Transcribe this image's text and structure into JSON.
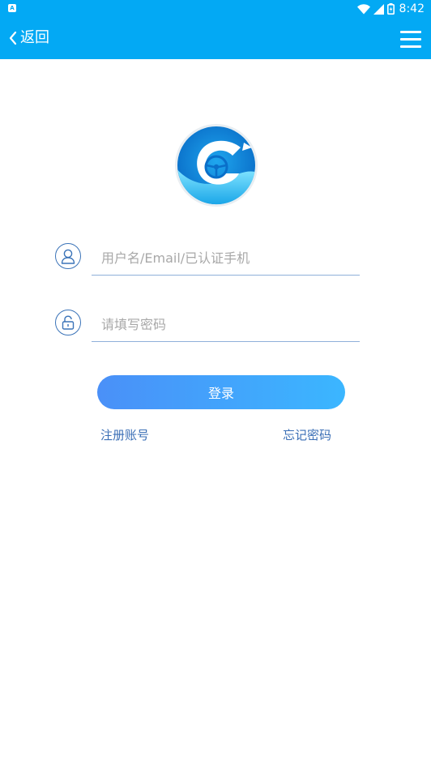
{
  "status_bar": {
    "time": "8:42",
    "left_icon": "A",
    "icons": [
      "wifi-icon",
      "signal-icon",
      "battery-icon"
    ]
  },
  "header": {
    "back_label": "返回",
    "menu_icon": "hamburger-menu-icon",
    "background": "#03a9f4"
  },
  "logo": {
    "icon": "steering-wheel-logo"
  },
  "form": {
    "username": {
      "placeholder": "用户名/Email/已认证手机",
      "value": "",
      "icon": "user-icon"
    },
    "password": {
      "placeholder": "请填写密码",
      "value": "",
      "icon": "lock-icon"
    },
    "login_label": "登录",
    "register_label": "注册账号",
    "forgot_label": "忘记密码"
  },
  "colors": {
    "accent": "#03a9f4",
    "button_start": "#4a90f8",
    "button_end": "#3bb6ff",
    "link": "#3b6fb6"
  }
}
